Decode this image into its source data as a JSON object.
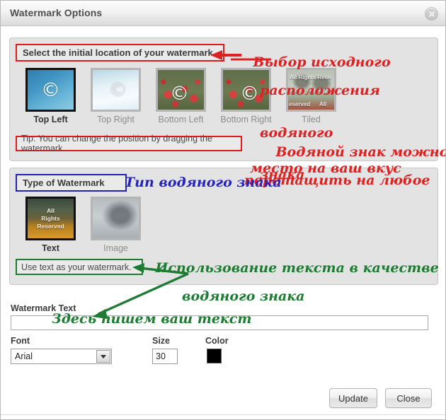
{
  "window": {
    "title": "Watermark Options",
    "close_icon": "close-icon"
  },
  "location_section": {
    "header": "Select the initial location of your watermark",
    "tip": "Tip: You can change the position by dragging the watermark.",
    "options": [
      {
        "label": "Top Left",
        "selected": true
      },
      {
        "label": "Top Right",
        "selected": false
      },
      {
        "label": "Bottom Left",
        "selected": false
      },
      {
        "label": "Bottom Right",
        "selected": false
      },
      {
        "label": "Tiled",
        "selected": false
      }
    ],
    "thumb_overlay_text": "All Rights Reserved",
    "tile_words": [
      "All Rights Rese",
      "ved",
      "All Rights",
      "eserved",
      "All"
    ]
  },
  "type_section": {
    "header": "Type of Watermark",
    "note": "Use text as your watermark.",
    "options": [
      {
        "label": "Text",
        "selected": true,
        "overlay": [
          "All",
          "Rights",
          "Reserved"
        ]
      },
      {
        "label": "Image",
        "selected": false,
        "overlay": []
      }
    ]
  },
  "form": {
    "watermark_text_label": "Watermark Text",
    "watermark_text_value": "",
    "font_label": "Font",
    "font_value": "Arial",
    "size_label": "Size",
    "size_value": "30",
    "color_label": "Color",
    "color_value": "#000000"
  },
  "footer": {
    "update_label": "Update",
    "close_label": "Close"
  },
  "annotations": {
    "red_location": {
      "line1": "Выбор исходного",
      "line2": "расположения",
      "line3": "водяного",
      "line4": "знака"
    },
    "red_drag": {
      "line1": "Водяной знак можно",
      "line2": "перетащить на любое",
      "line3": "место на ваш вкус"
    },
    "blue_type": "Тип водяного знака",
    "green_usetext": {
      "line1": "Использование текста в качестве",
      "line2": "водяного знака"
    },
    "green_input": "Здесь пишем ваш текст",
    "colors": {
      "red": "#e02020",
      "blue": "#2323c2",
      "green": "#1d7c32"
    }
  }
}
